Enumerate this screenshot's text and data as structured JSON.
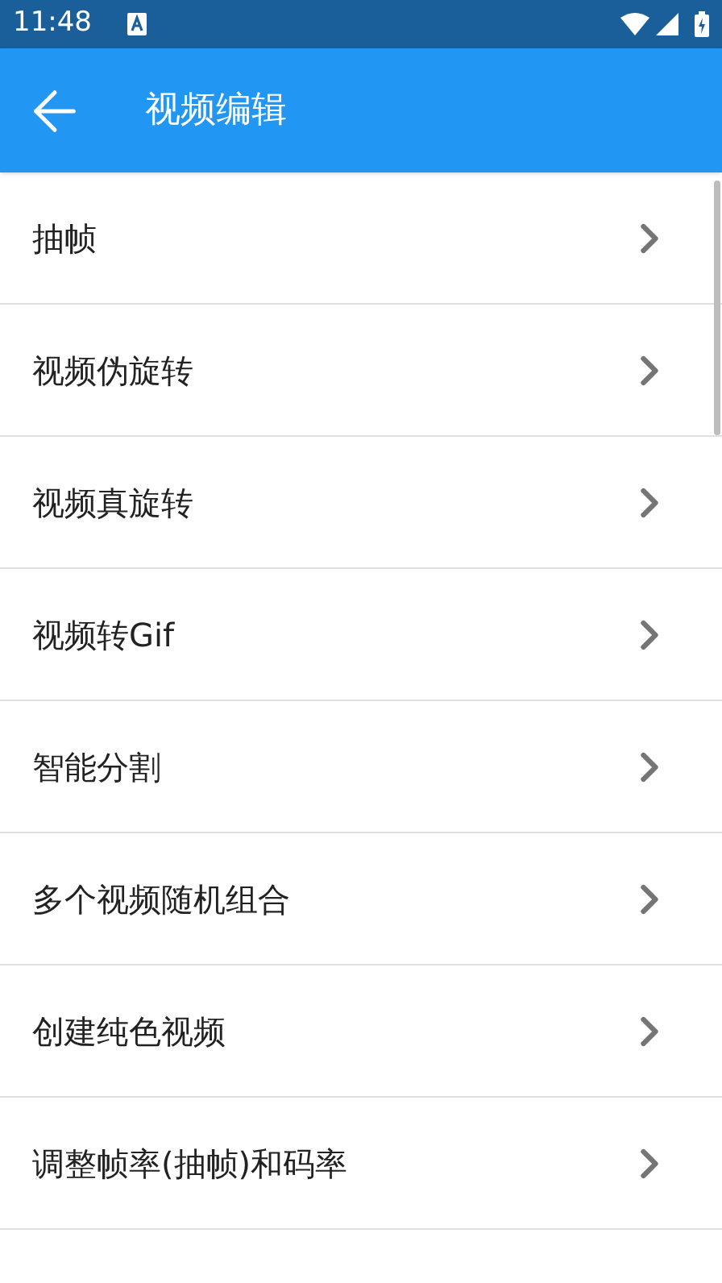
{
  "status_bar": {
    "time": "11:48"
  },
  "app_bar": {
    "title": "视频编辑"
  },
  "items": [
    {
      "label": "抽帧"
    },
    {
      "label": "视频伪旋转"
    },
    {
      "label": "视频真旋转"
    },
    {
      "label": "视频转Gif"
    },
    {
      "label": "智能分割"
    },
    {
      "label": "多个视频随机组合"
    },
    {
      "label": "创建纯色视频"
    },
    {
      "label": "调整帧率(抽帧)和码率"
    }
  ]
}
